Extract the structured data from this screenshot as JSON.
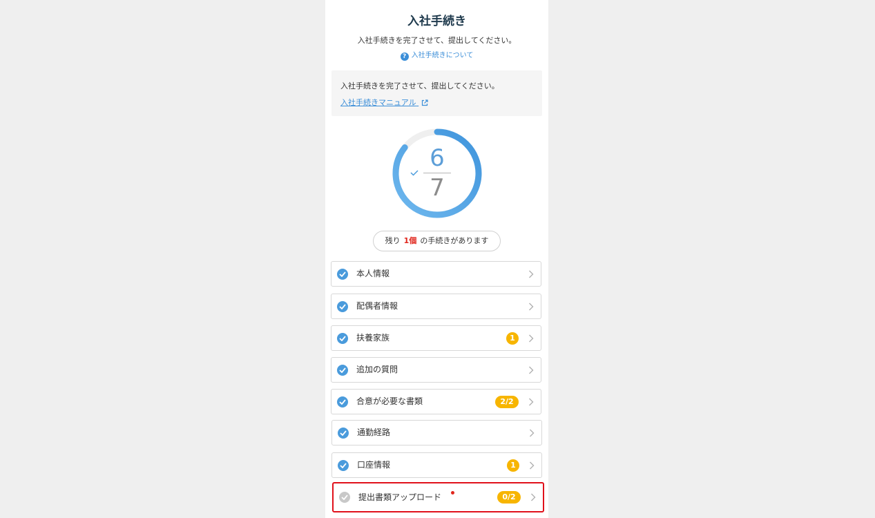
{
  "header": {
    "title": "入社手続き",
    "subtitle": "入社手続きを完了させて、提出してください。",
    "help_link": "入社手続きについて",
    "help_icon_glyph": "?"
  },
  "info_box": {
    "text": "入社手続きを完了させて、提出してください。",
    "manual_link": "入社手続きマニュアル",
    "manual_icon": "external-link-icon"
  },
  "progress": {
    "completed": "6",
    "total": "7",
    "fraction": 0.857,
    "ring_color": "#4a9bdc",
    "track_color": "#efefef"
  },
  "remaining": {
    "prefix": "残り",
    "count": "1個",
    "suffix": "の手続きがあります"
  },
  "items": [
    {
      "label": "本人情報",
      "badge": "",
      "status": "done"
    },
    {
      "label": "配偶者情報",
      "badge": "",
      "status": "done"
    },
    {
      "label": "扶養家族",
      "badge": "1",
      "status": "done"
    },
    {
      "label": "追加の質問",
      "badge": "",
      "status": "done"
    },
    {
      "label": "合意が必要な書類",
      "badge": "2/2",
      "status": "done"
    },
    {
      "label": "通勤経路",
      "badge": "",
      "status": "done"
    },
    {
      "label": "口座情報",
      "badge": "1",
      "status": "done"
    },
    {
      "label": "提出書類アップロード",
      "badge": "0/2",
      "status": "pending"
    }
  ],
  "colors": {
    "accent": "#3b8ed8",
    "badge": "#f7b500",
    "alert": "#e0261c",
    "highlight_border": "#e0101a"
  }
}
